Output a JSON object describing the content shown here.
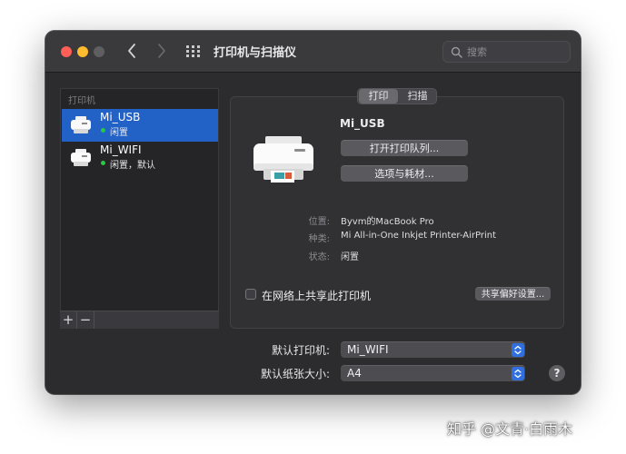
{
  "window": {
    "title": "打印机与扫描仪",
    "search_placeholder": "搜索"
  },
  "sidebar": {
    "header": "打印机",
    "printers": [
      {
        "name": "Mi_USB",
        "status": "闲置",
        "selected": true
      },
      {
        "name": "Mi_WIFI",
        "status": "闲置，默认",
        "selected": false
      }
    ],
    "add_label": "+",
    "remove_label": "−"
  },
  "detail": {
    "tabs": [
      {
        "label": "打印",
        "active": true
      },
      {
        "label": "扫描",
        "active": false
      }
    ],
    "printer_name": "Mi_USB",
    "open_queue_label": "打开打印队列...",
    "options_label": "选项与耗材...",
    "info": [
      {
        "label": "位置:",
        "value": "Byvm的MacBook Pro"
      },
      {
        "label": "种类:",
        "value": "Mi All-in-One Inkjet Printer-AirPrint"
      },
      {
        "label": "状态:",
        "value": "闲置"
      }
    ],
    "share_label": "在网络上共享此打印机",
    "share_checked": false,
    "share_prefs_label": "共享偏好设置..."
  },
  "defaults": {
    "default_printer_label": "默认打印机:",
    "default_printer_value": "Mi_WIFI",
    "default_paper_label": "默认纸张大小:",
    "default_paper_value": "A4",
    "help_label": "?"
  },
  "watermark": "知乎 @文青·白雨木",
  "colors": {
    "selection": "#2261c6",
    "status_idle": "#28c840",
    "close": "#fe5f57",
    "minimize": "#febc2e"
  }
}
